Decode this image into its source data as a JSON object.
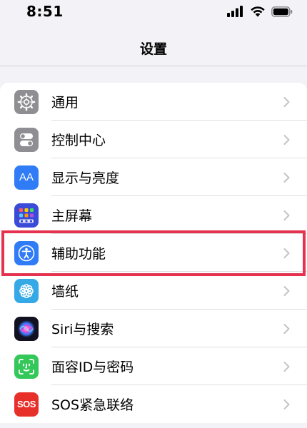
{
  "status_bar": {
    "time": "8:51",
    "icons": [
      "cellular-signal-icon",
      "wifi-icon",
      "battery-icon"
    ]
  },
  "nav": {
    "title": "设置"
  },
  "settings": [
    {
      "label": "通用",
      "icon": "gear-icon",
      "icon_color": "#8e8e93"
    },
    {
      "label": "控制中心",
      "icon": "toggles-icon",
      "icon_color": "#8e8e93"
    },
    {
      "label": "显示与亮度",
      "icon": "aa-text-size-icon",
      "icon_color": "#2f7cf6",
      "icon_text": "AA"
    },
    {
      "label": "主屏幕",
      "icon": "home-screen-grid-icon",
      "icon_color": "#3a4bd8"
    },
    {
      "label": "辅助功能",
      "icon": "accessibility-icon",
      "icon_color": "#2f7cf6"
    },
    {
      "label": "墙纸",
      "icon": "wallpaper-flower-icon",
      "icon_color": "#35a8e6"
    },
    {
      "label": "Siri与搜索",
      "icon": "siri-icon",
      "icon_color": "#1a1a2e"
    },
    {
      "label": "面容ID与密码",
      "icon": "face-id-icon",
      "icon_color": "#34c759"
    },
    {
      "label": "SOS紧急联络",
      "icon": "sos-icon",
      "icon_color": "#e8302b",
      "icon_text": "SOS"
    }
  ],
  "highlight": {
    "target": "辅助功能",
    "color": "#e5334f"
  }
}
